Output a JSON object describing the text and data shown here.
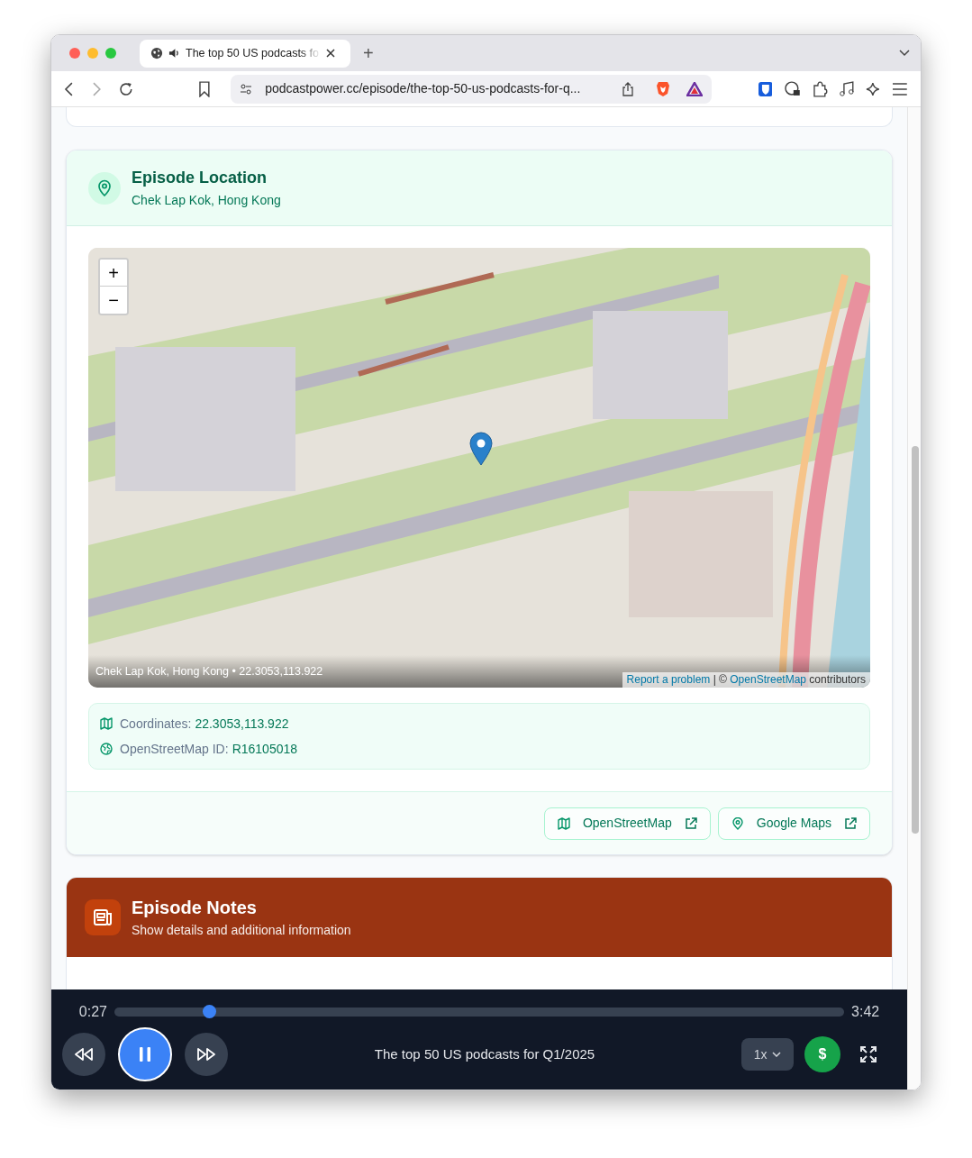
{
  "browser": {
    "tab_title": "The top 50 US podcasts fo",
    "new_tab": "+",
    "url": "podcastpower.cc/episode/the-top-50-us-podcasts-for-q..."
  },
  "location_card": {
    "title": "Episode Location",
    "subtitle": "Chek Lap Kok, Hong Kong",
    "map": {
      "zoom_in": "+",
      "zoom_out": "−",
      "caption": "Chek Lap Kok, Hong Kong • 22.3053,113.922",
      "report_link": "Report a problem",
      "separator": "| ©",
      "osm_link": "OpenStreetMap",
      "suffix": "contributors"
    },
    "details": [
      {
        "kind": "map",
        "label": "Coordinates:",
        "value": "22.3053,113.922"
      },
      {
        "kind": "globe",
        "label": "OpenStreetMap ID:",
        "value": "R16105018"
      }
    ],
    "buttons": [
      {
        "kind": "map",
        "label": "OpenStreetMap"
      },
      {
        "kind": "pin",
        "label": "Google Maps"
      }
    ]
  },
  "notes_card": {
    "title": "Episode Notes",
    "subtitle": "Show details and additional information"
  },
  "player": {
    "elapsed": "0:27",
    "duration": "3:42",
    "level": 0.13,
    "playing": true,
    "title": "The top 50 US podcasts for Q1/2025",
    "speed": "1x",
    "donate_symbol": "$"
  }
}
